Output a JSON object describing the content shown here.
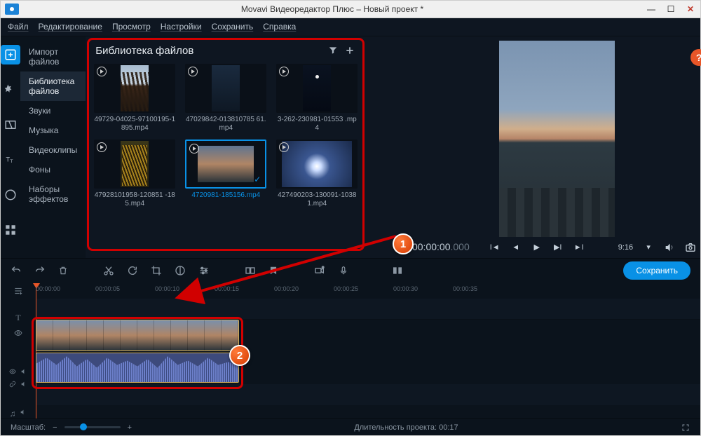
{
  "window": {
    "title": "Movavi Видеоредактор Плюс – Новый проект *"
  },
  "menu": {
    "file": "Файл",
    "edit": "Редактирование",
    "view": "Просмотр",
    "settings": "Настройки",
    "save": "Сохранить",
    "help": "Справка"
  },
  "sidebar": {
    "items": [
      "Импорт файлов",
      "Библиотека файлов",
      "Звуки",
      "Музыка",
      "Видеоклипы",
      "Фоны",
      "Наборы эффектов"
    ]
  },
  "library": {
    "title": "Библиотека файлов",
    "files": [
      "49729-04025-97100195-1895.mp4",
      "47029842-013810785 61.mp4",
      "3-262-230981-01553 .mp4",
      "47928101958-120851 -185.mp4",
      "4720981-185156.mp4",
      "427490203-130091-10381.mp4"
    ]
  },
  "preview": {
    "timecode_main": "00:00:00",
    "timecode_ms": ".000",
    "duration": "9:16",
    "help": "?"
  },
  "timeline": {
    "ticks": [
      "00:00:00",
      "00:00:05",
      "00:00:10",
      "00:00:15",
      "00:00:20",
      "00:00:25",
      "00:00:30",
      "00:00:35"
    ],
    "save_btn": "Сохранить"
  },
  "status": {
    "zoom_label": "Масштаб:",
    "duration_label": "Длительность проекта:  00:17"
  },
  "annotations": {
    "marker1": "1",
    "marker2": "2"
  }
}
